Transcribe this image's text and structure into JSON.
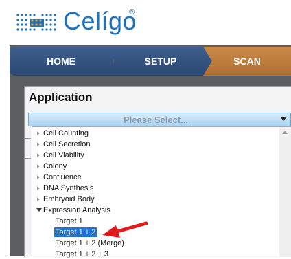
{
  "brand": {
    "name": "Celígo",
    "registered": "®"
  },
  "nav": {
    "tabs": [
      "HOME",
      "SETUP",
      "SCAN"
    ]
  },
  "panel": {
    "title": "Application"
  },
  "select": {
    "placeholder": "Please Select..."
  },
  "list": {
    "categories": [
      "Cell Counting",
      "Cell Secretion",
      "Cell Viability",
      "Colony",
      "Confluence",
      "DNA Synthesis",
      "Embryoid Body",
      "Expression Analysis"
    ],
    "children": [
      "Target 1",
      "Target 1 + 2",
      "Target 1 + 2 (Merge)",
      "Target 1 + 2 + 3"
    ],
    "selected_child": "Target 1 + 2"
  },
  "colors": {
    "brand_blue": "#1e73be",
    "nav_blue": "#2f4f7c",
    "nav_orange": "#b8773a",
    "selection_blue": "#1e73d6",
    "arrow_red": "#e01b1b"
  }
}
